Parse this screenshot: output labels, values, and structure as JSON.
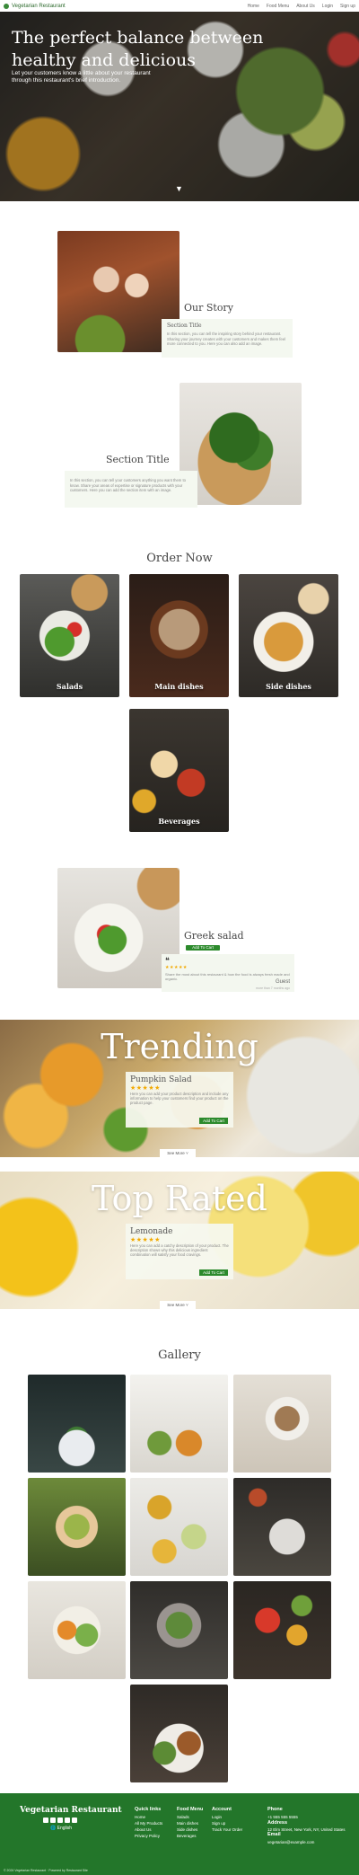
{
  "nav": {
    "brand": "Vegetarian Restaurant",
    "links": [
      "Home",
      "Food Menu",
      "About Us",
      "Login",
      "Sign up"
    ]
  },
  "hero": {
    "title": "The perfect balance between healthy and delicious",
    "subtitle": "Let your customers know a little about your restaurant through this restaurant's brief introduction.",
    "scroll_icon": "chevron-down-icon"
  },
  "story": {
    "heading": "Our Story",
    "card_title": "Section Title",
    "card_text": "In this section, you can tell the inspiring story behind your restaurant. Sharing your journey creates with your customers and makes them feel more connected to you. Here you can also add an image."
  },
  "section2": {
    "heading": "Section Title",
    "text": "In this section, you can tell your customers anything you want them to know. Share your areas of expertise or signature products with your customers. Here you can add the section item with an image."
  },
  "order": {
    "heading": "Order Now",
    "categories": [
      "Salads",
      "Main dishes",
      "Side dishes",
      "Beverages"
    ]
  },
  "featured": {
    "name": "Greek salad",
    "button": "Add To Cart",
    "review_stars": "★★★★★",
    "review_text": "Share the most about this restaurant & how the food is always fresh made and organic.",
    "reviewer": "Guest",
    "review_time": "more than 7 months ago"
  },
  "trending": {
    "title": "Trending",
    "item_name": "Pumpkin Salad",
    "stars": "★★★★★",
    "description": "Here you can add your product description and include any information to help your customers find your product on the product page.",
    "button": "Add To Cart",
    "more": "See More"
  },
  "top_rated": {
    "title": "Top Rated",
    "item_name": "Lemonade",
    "stars": "★★★★★",
    "description": "Here you can add a catchy description of your product. The description shows why this delicious ingredient combination will satisfy your food cravings.",
    "button": "Add To Cart",
    "more": "See More"
  },
  "gallery": {
    "heading": "Gallery"
  },
  "footer": {
    "brand": "Vegetarian Restaurant",
    "language": "English",
    "quick_links": {
      "heading": "Quick links",
      "items": [
        "Home",
        "All My Products",
        "About Us",
        "Privacy Policy"
      ]
    },
    "food_menu": {
      "heading": "Food Menu",
      "items": [
        "Salads",
        "Main dishes",
        "Side dishes",
        "Beverages"
      ]
    },
    "account": {
      "heading": "Account",
      "items": [
        "Login",
        "Sign up",
        "Track Your Order"
      ]
    },
    "phone": {
      "heading": "Phone",
      "value": "+1 555 555 5555"
    },
    "address": {
      "heading": "Address",
      "value": "12 Elm Street, New York, NY, United States"
    },
    "email": {
      "heading": "Email",
      "value": "vegetarian@example.com"
    },
    "copyright": "© 2024 Vegetarian Restaurant · Powered by Restaurant Site"
  }
}
